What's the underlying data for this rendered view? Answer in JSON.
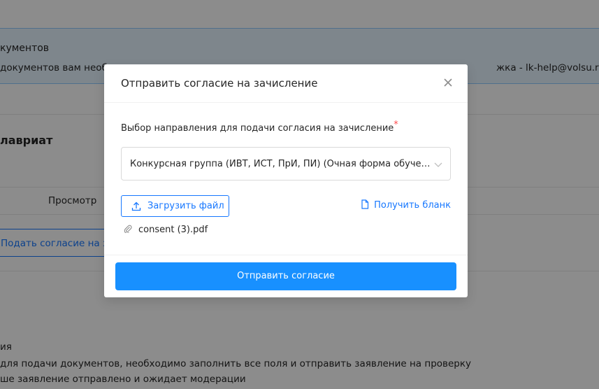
{
  "background": {
    "info_title": "кументов",
    "info_text_left": "документов вам необх",
    "info_text_right": "жка - lk-help@volsu.ru",
    "card_title": "лавриат",
    "table_column": "Просмотр",
    "link_button": "Подать согласие на зачи",
    "status_label": "ия",
    "status_line1": "для подачи документов, необходимо заполнить все поля и отправить заявление на проверку",
    "status_line2": "ше заявление отправлено и ожидает модерации"
  },
  "modal": {
    "title": "Отправить согласие на зачисление",
    "close_icon": "close-icon",
    "field_label": "Выбор направления для подачи согласия на зачисление",
    "required_mark": "*",
    "select_value": "Конкурсная группа (ИВТ, ИСТ, ПрИ, ПИ) (Очная форма обучения)",
    "upload_label": "Загрузить файл",
    "get_form_label": "Получить бланк",
    "file_name": "consent (3).pdf",
    "submit_label": "Отправить согласие"
  },
  "colors": {
    "primary": "#1890ff",
    "link": "#1677ff",
    "required": "#ff4d4f",
    "mask": "rgba(0,0,0,0.45)"
  }
}
